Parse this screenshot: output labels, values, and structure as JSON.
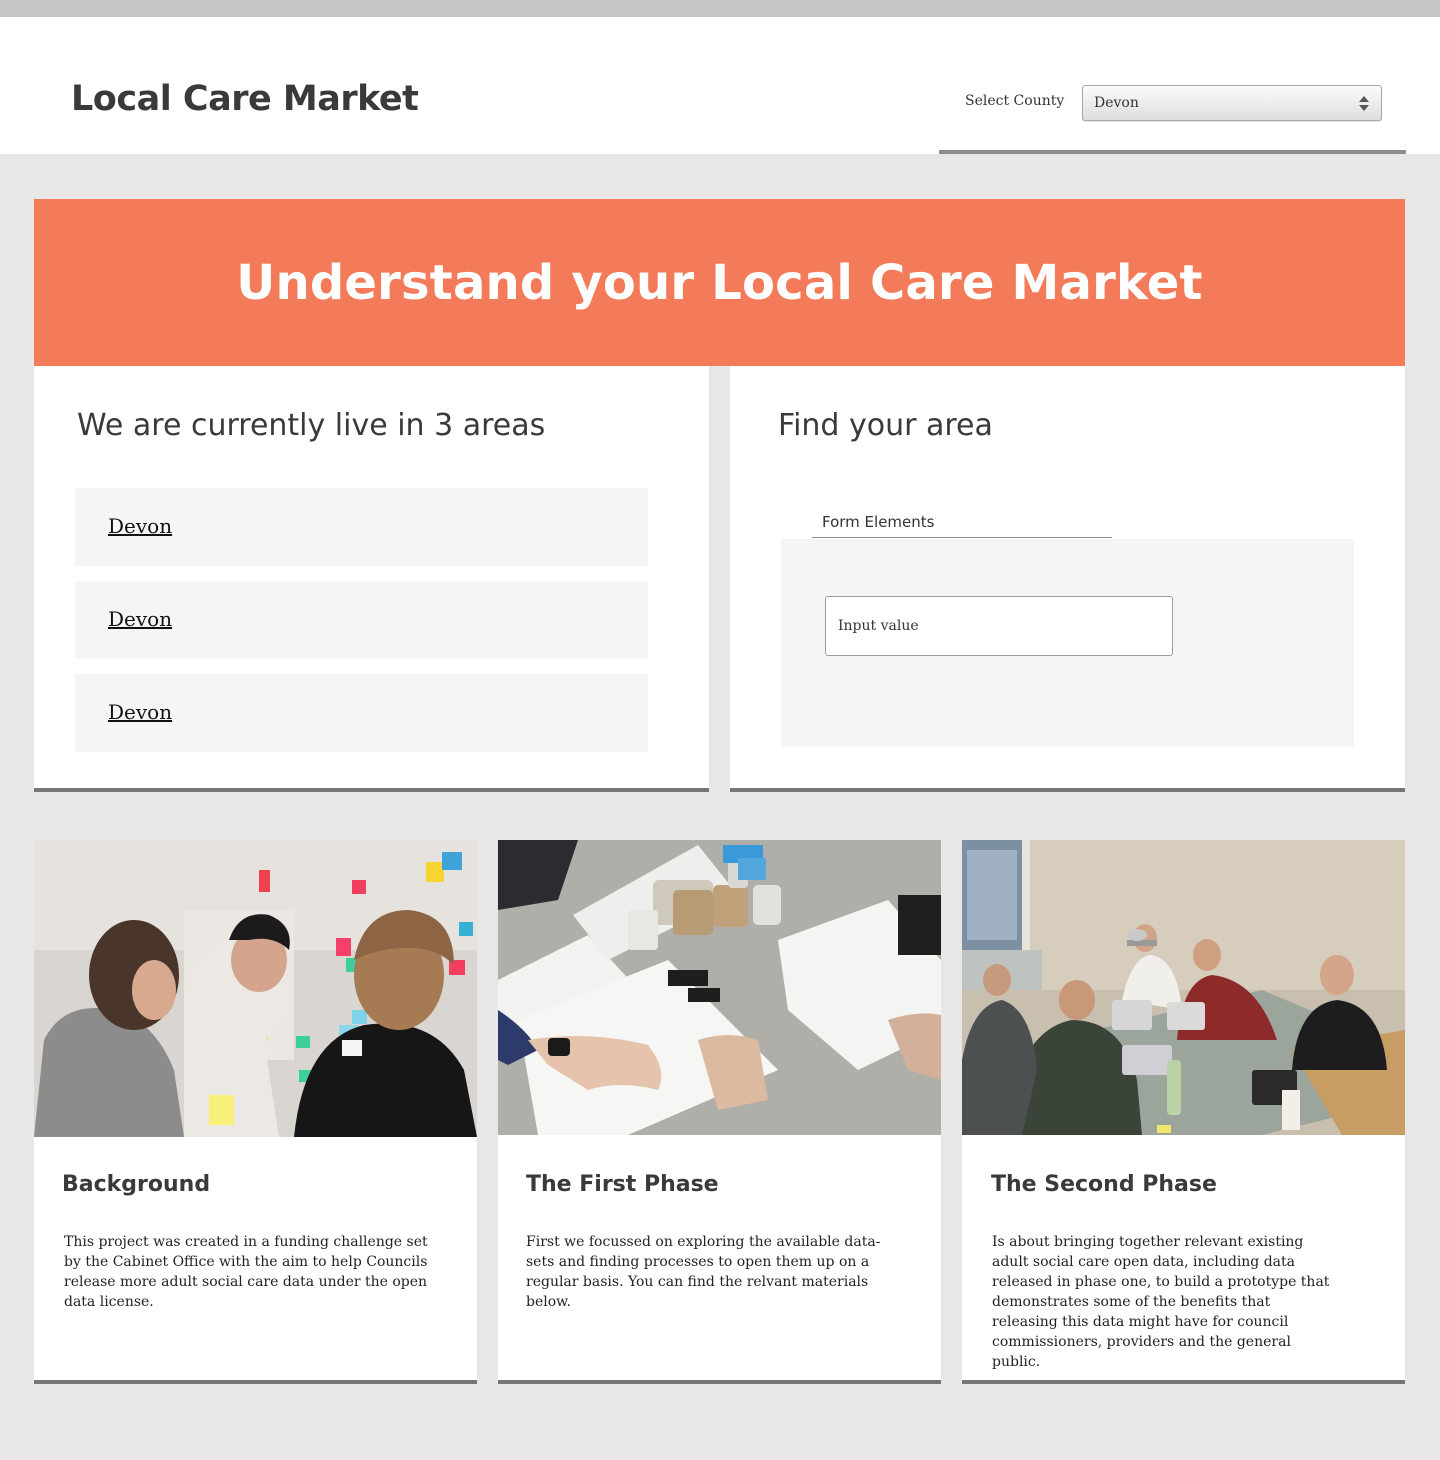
{
  "header": {
    "title": "Local Care Market",
    "county_label": "Select County",
    "county_selected": "Devon"
  },
  "hero": {
    "title": "Understand your Local Care Market"
  },
  "live_areas": {
    "heading": "We are currently live in 3 areas",
    "items": [
      "Devon",
      "Devon",
      "Devon"
    ]
  },
  "find_area": {
    "heading": "Find your area",
    "tab_label": "Form Elements",
    "input_placeholder": "Input value"
  },
  "cards": [
    {
      "title": "Background",
      "text": "This project was created in a funding challenge set by the Cabinet Office with the aim to help Councils release more adult social care data under the open data license."
    },
    {
      "title": "The First Phase",
      "text": "First we focussed on exploring the available data-sets and finding processes to open them up on a regular basis. You can find the relvant materials below."
    },
    {
      "title": "The Second Phase",
      "text": "Is about bringing together relevant existing adult social care open data, including data released in phase one, to build a prototype that demonstrates some of the benefits that releasing this data might have for council commissioners, providers and the general public."
    }
  ],
  "colors": {
    "hero_bg": "#f37b5a",
    "page_bg": "#e8e7e5",
    "panel_bg": "#ffffff",
    "item_bg": "#f5f5f5"
  }
}
